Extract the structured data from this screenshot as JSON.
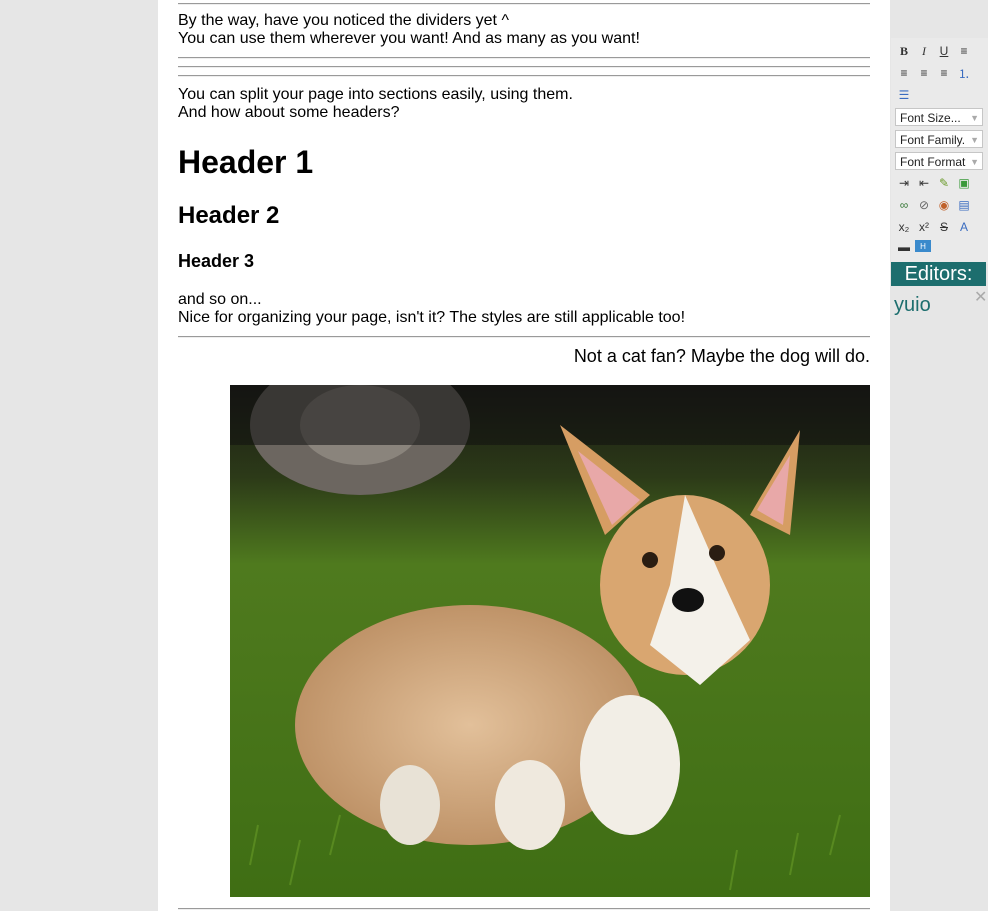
{
  "article": {
    "p1_line1": "By the way, have you noticed the dividers yet ^",
    "p1_line2": "You can use them wherever you want! And as many as you want!",
    "p2_line1": "You can split your page into sections easily, using them.",
    "p2_line2": "And how about some headers?",
    "h1": "Header 1",
    "h2": "Header 2",
    "h3": "Header 3",
    "p3_line1": "and so on...",
    "p3_line2": "Nice for organizing your page, isn't it? The styles are still applicable too!",
    "dog_caption": "Not a cat fan? Maybe the dog will do."
  },
  "toolbar": {
    "icons": [
      "bold-icon",
      "italic-icon",
      "underline-icon",
      "align-left-icon",
      "align-center-icon",
      "align-right-icon",
      "justify-icon",
      "ordered-list-icon",
      "unordered-list-icon",
      "indent-icon",
      "outdent-icon",
      "edit-icon",
      "insert-image-icon",
      "link-icon",
      "unlink-icon",
      "anchor-icon",
      "edit-page-icon",
      "subscript-icon",
      "superscript-icon",
      "strikethrough-icon",
      "remove-format-icon",
      "horizontal-rule-icon",
      "html-icon"
    ],
    "font_size": "Font Size...",
    "font_family": "Font Family.",
    "font_format": "Font Format"
  },
  "editors": {
    "title": "Editors:",
    "names": [
      "yuio"
    ]
  }
}
